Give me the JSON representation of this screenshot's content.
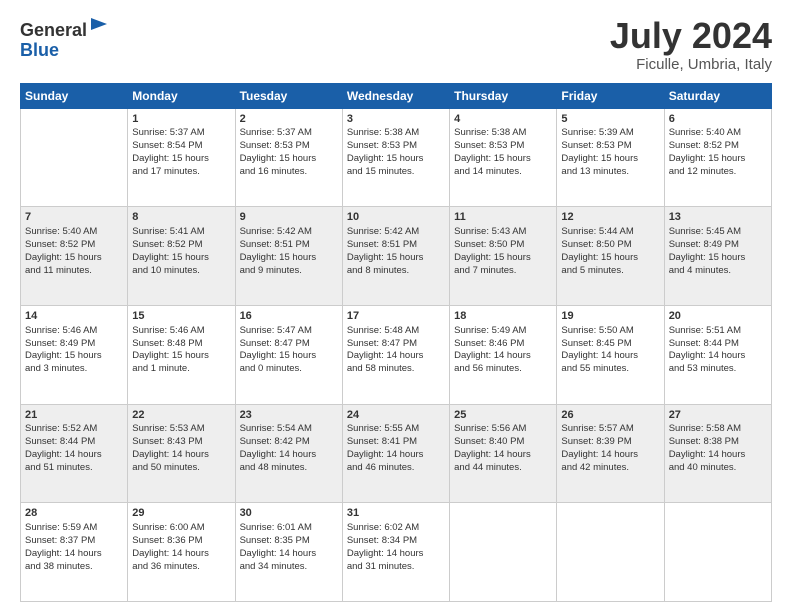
{
  "header": {
    "logo_line1": "General",
    "logo_line2": "Blue",
    "title": "July 2024",
    "location": "Ficulle, Umbria, Italy"
  },
  "weekdays": [
    "Sunday",
    "Monday",
    "Tuesday",
    "Wednesday",
    "Thursday",
    "Friday",
    "Saturday"
  ],
  "weeks": [
    [
      {
        "day": "",
        "info": ""
      },
      {
        "day": "1",
        "info": "Sunrise: 5:37 AM\nSunset: 8:54 PM\nDaylight: 15 hours\nand 17 minutes."
      },
      {
        "day": "2",
        "info": "Sunrise: 5:37 AM\nSunset: 8:53 PM\nDaylight: 15 hours\nand 16 minutes."
      },
      {
        "day": "3",
        "info": "Sunrise: 5:38 AM\nSunset: 8:53 PM\nDaylight: 15 hours\nand 15 minutes."
      },
      {
        "day": "4",
        "info": "Sunrise: 5:38 AM\nSunset: 8:53 PM\nDaylight: 15 hours\nand 14 minutes."
      },
      {
        "day": "5",
        "info": "Sunrise: 5:39 AM\nSunset: 8:53 PM\nDaylight: 15 hours\nand 13 minutes."
      },
      {
        "day": "6",
        "info": "Sunrise: 5:40 AM\nSunset: 8:52 PM\nDaylight: 15 hours\nand 12 minutes."
      }
    ],
    [
      {
        "day": "7",
        "info": "Sunrise: 5:40 AM\nSunset: 8:52 PM\nDaylight: 15 hours\nand 11 minutes."
      },
      {
        "day": "8",
        "info": "Sunrise: 5:41 AM\nSunset: 8:52 PM\nDaylight: 15 hours\nand 10 minutes."
      },
      {
        "day": "9",
        "info": "Sunrise: 5:42 AM\nSunset: 8:51 PM\nDaylight: 15 hours\nand 9 minutes."
      },
      {
        "day": "10",
        "info": "Sunrise: 5:42 AM\nSunset: 8:51 PM\nDaylight: 15 hours\nand 8 minutes."
      },
      {
        "day": "11",
        "info": "Sunrise: 5:43 AM\nSunset: 8:50 PM\nDaylight: 15 hours\nand 7 minutes."
      },
      {
        "day": "12",
        "info": "Sunrise: 5:44 AM\nSunset: 8:50 PM\nDaylight: 15 hours\nand 5 minutes."
      },
      {
        "day": "13",
        "info": "Sunrise: 5:45 AM\nSunset: 8:49 PM\nDaylight: 15 hours\nand 4 minutes."
      }
    ],
    [
      {
        "day": "14",
        "info": "Sunrise: 5:46 AM\nSunset: 8:49 PM\nDaylight: 15 hours\nand 3 minutes."
      },
      {
        "day": "15",
        "info": "Sunrise: 5:46 AM\nSunset: 8:48 PM\nDaylight: 15 hours\nand 1 minute."
      },
      {
        "day": "16",
        "info": "Sunrise: 5:47 AM\nSunset: 8:47 PM\nDaylight: 15 hours\nand 0 minutes."
      },
      {
        "day": "17",
        "info": "Sunrise: 5:48 AM\nSunset: 8:47 PM\nDaylight: 14 hours\nand 58 minutes."
      },
      {
        "day": "18",
        "info": "Sunrise: 5:49 AM\nSunset: 8:46 PM\nDaylight: 14 hours\nand 56 minutes."
      },
      {
        "day": "19",
        "info": "Sunrise: 5:50 AM\nSunset: 8:45 PM\nDaylight: 14 hours\nand 55 minutes."
      },
      {
        "day": "20",
        "info": "Sunrise: 5:51 AM\nSunset: 8:44 PM\nDaylight: 14 hours\nand 53 minutes."
      }
    ],
    [
      {
        "day": "21",
        "info": "Sunrise: 5:52 AM\nSunset: 8:44 PM\nDaylight: 14 hours\nand 51 minutes."
      },
      {
        "day": "22",
        "info": "Sunrise: 5:53 AM\nSunset: 8:43 PM\nDaylight: 14 hours\nand 50 minutes."
      },
      {
        "day": "23",
        "info": "Sunrise: 5:54 AM\nSunset: 8:42 PM\nDaylight: 14 hours\nand 48 minutes."
      },
      {
        "day": "24",
        "info": "Sunrise: 5:55 AM\nSunset: 8:41 PM\nDaylight: 14 hours\nand 46 minutes."
      },
      {
        "day": "25",
        "info": "Sunrise: 5:56 AM\nSunset: 8:40 PM\nDaylight: 14 hours\nand 44 minutes."
      },
      {
        "day": "26",
        "info": "Sunrise: 5:57 AM\nSunset: 8:39 PM\nDaylight: 14 hours\nand 42 minutes."
      },
      {
        "day": "27",
        "info": "Sunrise: 5:58 AM\nSunset: 8:38 PM\nDaylight: 14 hours\nand 40 minutes."
      }
    ],
    [
      {
        "day": "28",
        "info": "Sunrise: 5:59 AM\nSunset: 8:37 PM\nDaylight: 14 hours\nand 38 minutes."
      },
      {
        "day": "29",
        "info": "Sunrise: 6:00 AM\nSunset: 8:36 PM\nDaylight: 14 hours\nand 36 minutes."
      },
      {
        "day": "30",
        "info": "Sunrise: 6:01 AM\nSunset: 8:35 PM\nDaylight: 14 hours\nand 34 minutes."
      },
      {
        "day": "31",
        "info": "Sunrise: 6:02 AM\nSunset: 8:34 PM\nDaylight: 14 hours\nand 31 minutes."
      },
      {
        "day": "",
        "info": ""
      },
      {
        "day": "",
        "info": ""
      },
      {
        "day": "",
        "info": ""
      }
    ]
  ]
}
